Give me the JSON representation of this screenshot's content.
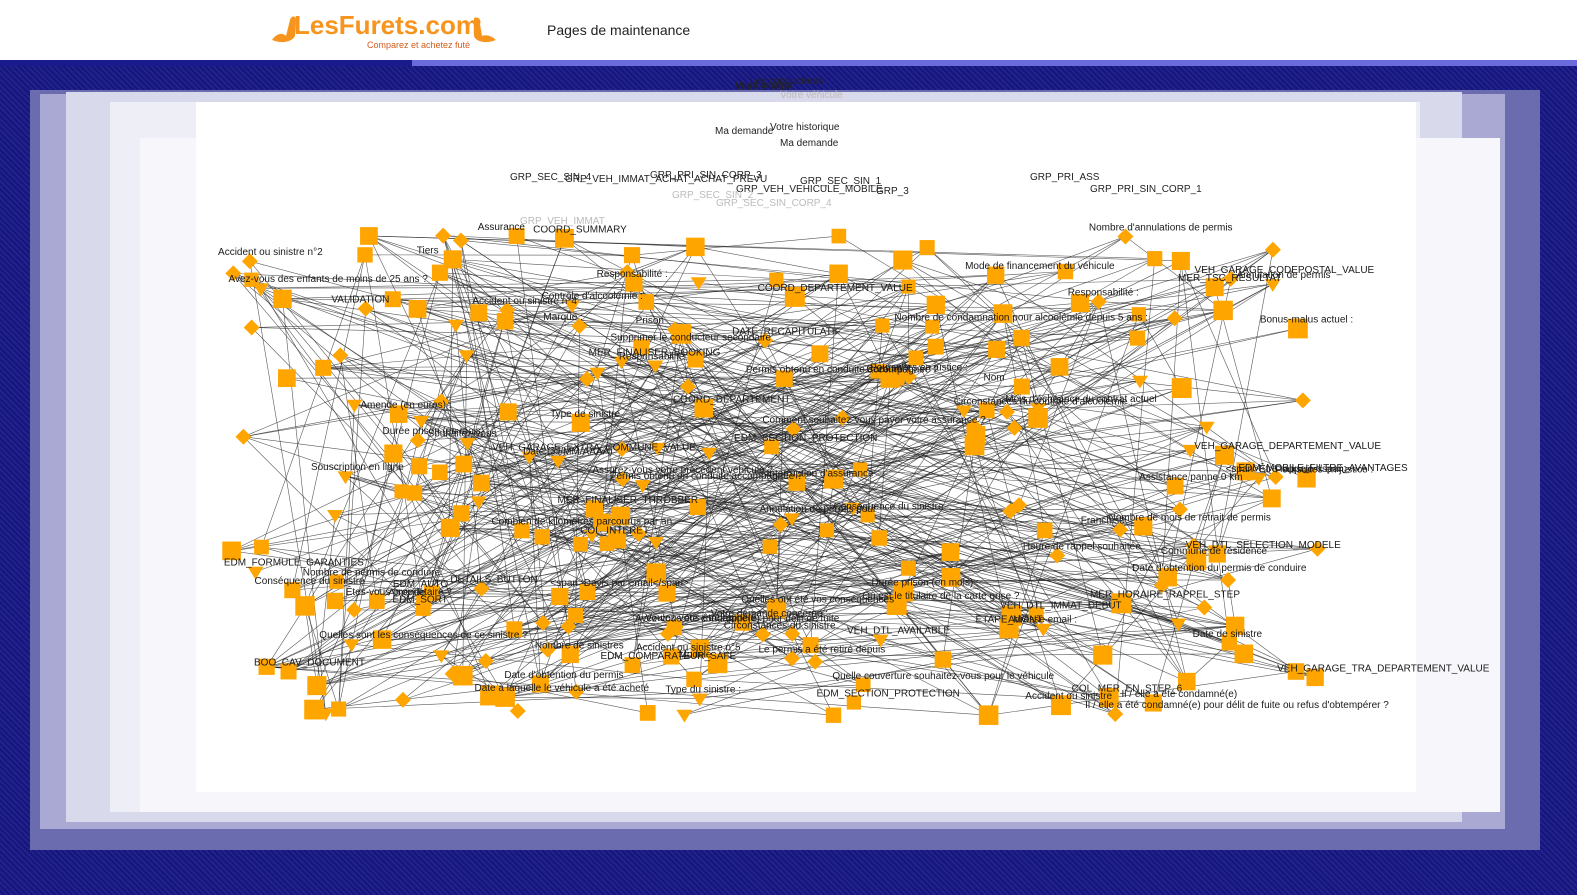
{
  "header": {
    "logo_text": "LesFurets.com",
    "logo_tagline": "Comparez et achetez futé",
    "page_title": "Pages de maintenance",
    "accent": "#f7941d",
    "brand_blue": "#1a1a8c"
  },
  "graph": {
    "node_color": "#ffa500",
    "edge_color": "#222222",
    "top_headers": [
      {
        "text": "Les conducteurs",
        "faint": false
      },
      {
        "text": "Vous assurer",
        "faint": false
      },
      {
        "text": "Votre sinistre",
        "faint": false
      },
      {
        "text": "Votre véhicule",
        "faint": true
      },
      {
        "text": "Votre historique",
        "faint": false
      },
      {
        "text": "Ma demande",
        "faint": false
      },
      {
        "text": "Ma demande",
        "faint": false
      },
      {
        "text": "GRP_SEC_SIN_4",
        "faint": false
      },
      {
        "text": "GRP_VEH_IMMAT_ACHAT_ACHAT_PREVU",
        "faint": false
      },
      {
        "text": "GRP_PRI_SIN_CORP_3",
        "faint": false
      },
      {
        "text": "GRP_SEC_SIN_1",
        "faint": false
      },
      {
        "text": "GRP_VEH_VEHICULE_MOBILE",
        "faint": false
      },
      {
        "text": "GRP_3",
        "faint": false
      },
      {
        "text": "GRP_PRI_ASS",
        "faint": false
      },
      {
        "text": "GRP_PRI_SIN_CORP_1",
        "faint": false
      },
      {
        "text": "GRP_SEC_SIN_2",
        "faint": true
      },
      {
        "text": "GRP_SEC_SIN_CORP_4",
        "faint": true
      },
      {
        "text": "GRP_VEH_IMMAT",
        "faint": true
      }
    ],
    "node_labels": [
      "<span>Être rappelé</span>",
      "COL_INTERET",
      "Il / elle a été condamné(e)",
      "MER_FINALISER_THROBBER",
      "Nombre de sinistres",
      "VEH_DTL_AVAILABLE",
      "COL_MER_EN_STEP_6",
      "Commune de résidence",
      "Permis obtenu en conduite accompagnée ?",
      "Type de sinistre",
      "EDM_FORMULE_GARANTIES",
      "Conséquence du sinistre",
      "Annulation de permis pour",
      "Accident ou sinistre n°4",
      "Êtes-vous propriétaire ?",
      "Nombre de mois de retrait de permis",
      "Responsabilité",
      "Accident ou sinistre n°5",
      "Nom",
      "VEH_GARAGE_DEPARTEMENT_VALUE",
      "COORD_DEPARTEMENT",
      "Avez-vous été condamné(e) pour délit de fuite",
      "VEH_DTL_IMMAT_DEBUT",
      "EDM_AUTO",
      "MER_HORAIRE_RAPPEL_STEP",
      "Mode de financement du véhicule",
      "Quelle couverture souhaitez-vous pour le véhicule",
      "COORD_SUMMARY",
      "Annulation de permis",
      "VALIDATION",
      "Amende",
      "VEH_GARAGE_EXTRA_COMMUNE_VALUE",
      "Nombre d'annulations de permis",
      "Combien de kilomètres parcourus par an",
      "VEH_GARAGE_TRA_DEPARTEMENT_VALUE",
      "Quelles ont été vos conséquences",
      "Date d'obtention du permis de conduire",
      "Date à laquelle le véhicule a été acheté",
      "Responsabilité :",
      "Date de sinistre",
      "Mois d'échéance du contrat actuel",
      "Durée prison (en mois) :",
      "MER_TSC_RESULTAT",
      "Poursuites en justice :",
      "EDM_COMPARATEUR_SAFE",
      "Marque :",
      "Contrôle d'alcoolémie :",
      "VEH_DTL_SELECTION_MODELE",
      "<span>Devis par email</span>",
      "Durée prison (en mois) :",
      "Votre demande concerne :",
      "Adresse email :",
      "Accident ou sinistre",
      "Permis obtenu en conduite accompagnée ?",
      "Poursuites en justice :",
      "Carburant :",
      "Amende (en euros) :",
      "Souscription en ligne",
      "Supprimer le conducteur secondaire",
      "Il / elle a été condamné(e) pour délit de fuite ou refus d'obtempérer ?",
      "Type du sinistre :",
      "Nombre de condamnation pour alcoolémie depuis 5 ans :",
      "Prison",
      "Circonstances du sinistre",
      "Bonus-malus actuel :",
      "Modèle",
      "Accident ou sinistre n°2",
      "COORD_DEPARTEMENT_VALUE",
      "Responsabilité :",
      "Voulez-vous être rappelé :",
      "Quelles sont les conséquences de ce sinistre ?",
      "Assurez-vous votre précédent véhicule ?",
      "Circonstances du contrôle d'alcoolémie :",
      "Nombre de permis de conduire",
      "Comment souhaitez-vous payer votre assurance ?",
      "Date (JJ/MM/AAAA)",
      "EDM_MOBILE_FILTRE_AVANTAGES",
      "VEH_GARAGE_CODEPOSTAL_VALUE",
      "Où est le titulaire de la carte grise ?",
      "Franchise",
      "EDM_SECTION_PROTECTION",
      "MER_FINALISER_BOOKING",
      "DATE_RECAPITULATIF",
      "Heure de rappel souhaitée",
      "Assistance panne 0 km",
      "Le permis a été retiré depuis",
      "Conséquence du sinistre",
      "BOO_CAV_DOCUMENT",
      "Interruption d'assurance",
      "Avez-vous des enfants de moins de 25 ans ?",
      "EDM_SORT",
      "Tiers",
      "ETAPE_MONT",
      "Date d'obtention du permis",
      "Assurance",
      "Souhaitez-vous",
      "EDM_SECTION_PROTECTION",
      "DETAILS_BUTTON"
    ]
  }
}
